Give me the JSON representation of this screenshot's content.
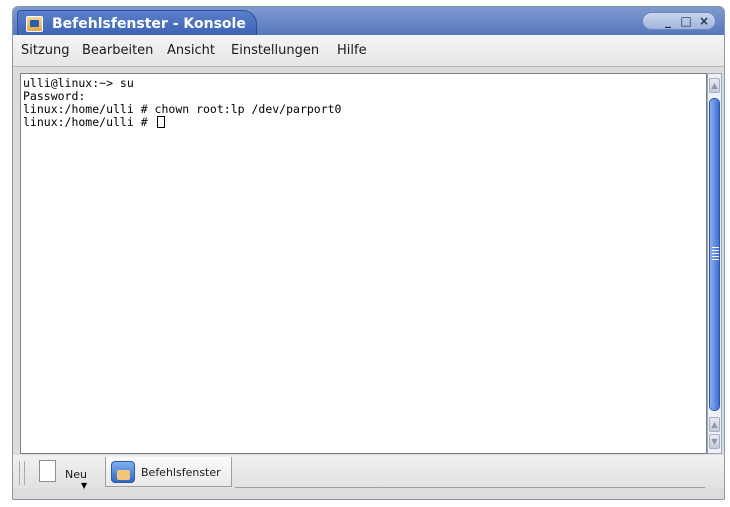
{
  "window": {
    "title": "Befehlsfenster - Konsole",
    "buttons": {
      "minimize": "_",
      "maximize": "□",
      "close": "×"
    }
  },
  "menubar": {
    "items": [
      "Sitzung",
      "Bearbeiten",
      "Ansicht",
      "Einstellungen",
      "Hilfe"
    ]
  },
  "terminal": {
    "lines": [
      "ulli@linux:~> su",
      "Password:",
      "linux:/home/ulli # chown root:lp /dev/parport0",
      "linux:/home/ulli # "
    ]
  },
  "scrollbar": {
    "up_arrow": "▲",
    "down_arrow": "▼"
  },
  "tabbar": {
    "new_label": "Neu",
    "new_dropdown": "▼",
    "session_label": "Befehlsfenster"
  },
  "icons": {
    "app": "konsole-app-icon",
    "new": "new-document-icon",
    "session": "konsole-session-icon"
  },
  "colors": {
    "titlebar": "#5677bd",
    "title_tab": "#3d64b4",
    "scrollbar_thumb": "#3f6fd3",
    "terminal_bg": "#ffffff"
  }
}
